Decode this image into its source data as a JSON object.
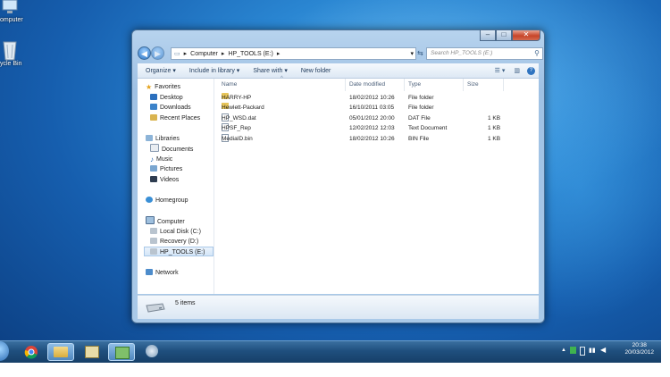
{
  "desktop": {
    "icons": [
      {
        "label": "omputer",
        "icon": "computer-icon"
      },
      {
        "label": "ycle Bin",
        "icon": "recycle-bin-icon"
      }
    ]
  },
  "explorer": {
    "address": {
      "root": "Computer",
      "current": "HP_TOOLS (E:)"
    },
    "search_placeholder": "Search HP_TOOLS (E:)",
    "toolbar": {
      "organize": "Organize",
      "include_in_library": "Include in library",
      "share_with": "Share with",
      "new_folder": "New folder"
    },
    "nav": {
      "favorites": "Favorites",
      "desktop": "Desktop",
      "downloads": "Downloads",
      "recent_places": "Recent Places",
      "libraries": "Libraries",
      "documents": "Documents",
      "music": "Music",
      "pictures": "Pictures",
      "videos": "Videos",
      "homegroup": "Homegroup",
      "computer": "Computer",
      "local_disk": "Local Disk (C:)",
      "recovery": "Recovery (D:)",
      "hp_tools": "HP_TOOLS (E:)",
      "network": "Network"
    },
    "columns": {
      "name": "Name",
      "date_modified": "Date modified",
      "type": "Type",
      "size": "Size"
    },
    "files": [
      {
        "name": "HARRY-HP",
        "date": "18/02/2012 10:26",
        "type": "File folder",
        "size": "",
        "icon": "globe-folder-icon"
      },
      {
        "name": "Hewlett-Packard",
        "date": "16/10/2011 03:05",
        "type": "File folder",
        "size": "",
        "icon": "folder-icon"
      },
      {
        "name": "HP_WSD.dat",
        "date": "05/01/2012 20:00",
        "type": "DAT File",
        "size": "1 KB",
        "icon": "file-icon"
      },
      {
        "name": "HPSF_Rep",
        "date": "12/02/2012 12:03",
        "type": "Text Document",
        "size": "1 KB",
        "icon": "text-file-icon"
      },
      {
        "name": "MediaID.bin",
        "date": "18/02/2012 10:26",
        "type": "BIN File",
        "size": "1 KB",
        "icon": "file-icon"
      }
    ],
    "status_text": "5 items"
  },
  "taskbar": {
    "time": "20:38",
    "date": "20/03/2012"
  }
}
